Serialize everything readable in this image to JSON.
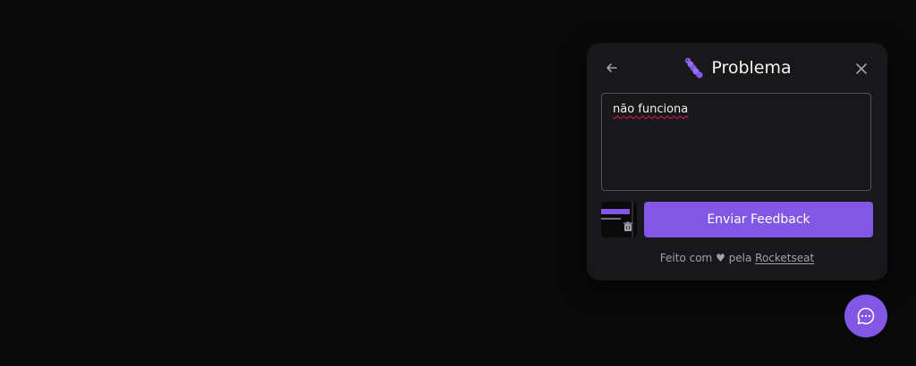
{
  "widget": {
    "title": "Problema",
    "title_icon": "worm-icon",
    "back_icon": "arrow-left-icon",
    "close_icon": "close-icon",
    "comment_value": "não funciona",
    "screenshot_thumbnail": "screenshot-thumbnail",
    "delete_icon": "trash-icon",
    "submit_label": "Enviar Feedback",
    "footer": {
      "prefix": "Feito com ♥ pela ",
      "link_text": "Rocketseat"
    }
  },
  "fab": {
    "icon": "chat-bubble-icon"
  },
  "colors": {
    "background": "#09090a",
    "panel": "#18181b",
    "accent": "#8257e5",
    "text": "#f4f4f5",
    "muted": "#a1a1aa",
    "border": "#52525b"
  }
}
